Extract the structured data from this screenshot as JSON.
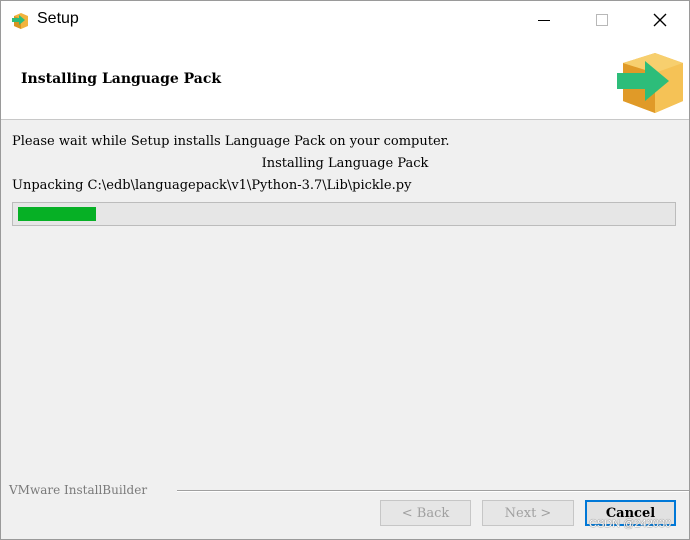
{
  "window": {
    "title": "Setup",
    "icon": "setup-package-icon"
  },
  "header": {
    "title": "Installing Language Pack",
    "logo": "box-arrow-logo"
  },
  "content": {
    "wait_message": "Please wait while Setup installs Language Pack on your computer.",
    "status_title": "Installing Language Pack",
    "current_file": "Unpacking C:\\edb\\languagepack\\v1\\Python-3.7\\Lib\\pickle.py",
    "progress_fraction": 0.12
  },
  "footer": {
    "brand": "VMware InstallBuilder",
    "back_label": "< Back",
    "next_label": "Next >",
    "cancel_label": "Cancel"
  },
  "watermark": "CSDN @242030",
  "colors": {
    "progress": "#06b025",
    "logo_box": "#f2b33d",
    "logo_arrow": "#2dbd7a",
    "focus_border": "#0078d7"
  }
}
